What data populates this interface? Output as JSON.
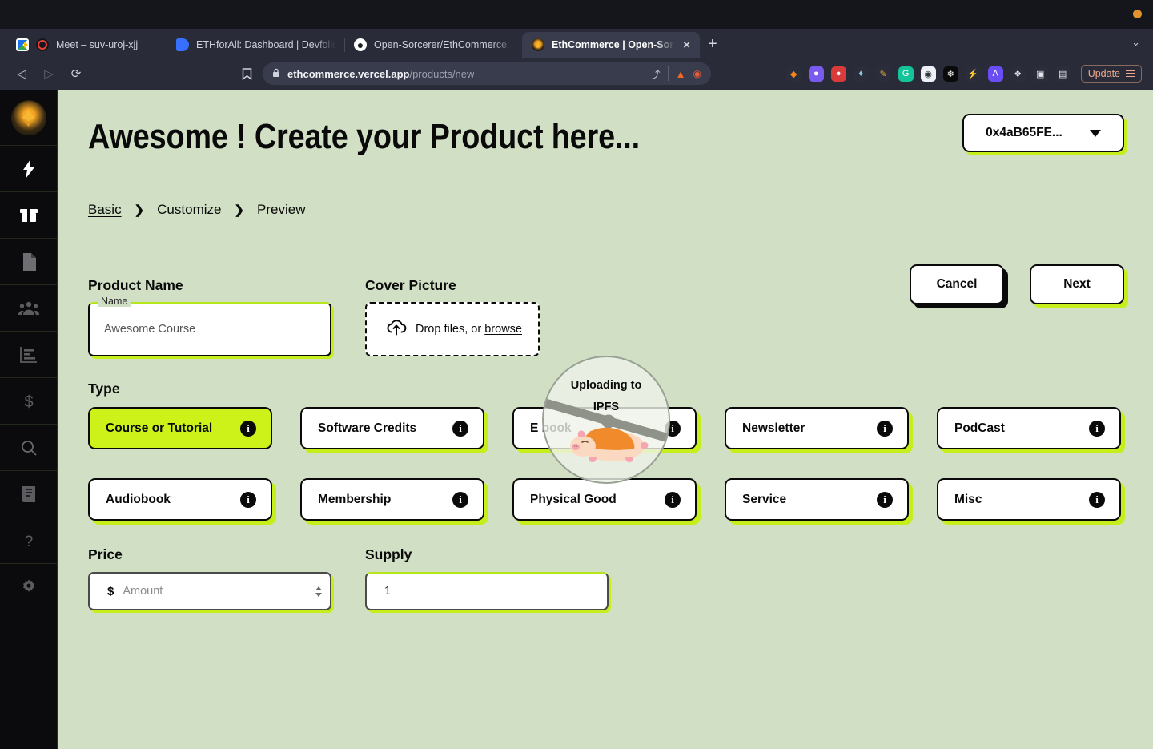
{
  "browser": {
    "tabs": [
      {
        "title": "Meet – suv-uroj-xjj",
        "favicon": "google-meet-icon",
        "active": false
      },
      {
        "title": "ETHforAll: Dashboard | Devfolio",
        "favicon": "devfolio-icon",
        "active": false
      },
      {
        "title": "Open-Sorcerer/EthCommerce: Toke",
        "favicon": "github-icon",
        "active": false
      },
      {
        "title": "EthCommerce | Open-Sorcerers",
        "favicon": "ethcommerce-icon",
        "active": true
      }
    ],
    "newtab_label": "+",
    "tab_close_label": "×",
    "tablist_chevron": "⌄",
    "nav": {
      "back": "◁",
      "forward": "▷",
      "reload": "⟳",
      "bookmark": "🔖"
    },
    "url": {
      "lock": "🔒",
      "domain": "ethcommerce.vercel.app",
      "path": "/products/new",
      "share": "⤴"
    },
    "extensions": [
      {
        "name": "metamask-extension",
        "glyph": "🦊",
        "color": "#2b2e3a"
      },
      {
        "name": "rabby-extension",
        "glyph": "●",
        "color": "#7a5bf0"
      },
      {
        "name": "keplr-extension",
        "glyph": "◆",
        "color": "#d93a3a"
      },
      {
        "name": "phantom-extension",
        "glyph": "⬧",
        "color": "#2b2e3a"
      },
      {
        "name": "colorpicker-extension",
        "glyph": "✒",
        "color": "#2b2e3a"
      },
      {
        "name": "grammarly-extension",
        "glyph": "G",
        "color": "#15c39a"
      },
      {
        "name": "coinbase-wallet-extension",
        "glyph": "●",
        "color": "#eef1f6"
      },
      {
        "name": "snowflake-extension",
        "glyph": "❄",
        "color": "#0a0a0a"
      },
      {
        "name": "lightning-extension",
        "glyph": "⚡",
        "color": "#2b2e3a"
      },
      {
        "name": "argent-extension",
        "glyph": "A",
        "color": "#6b4df6"
      },
      {
        "name": "puzzle-extensions-icon",
        "glyph": "🧩",
        "color": "#2b2e3a"
      },
      {
        "name": "sidepanel-icon",
        "glyph": "◱",
        "color": "#2b2e3a"
      },
      {
        "name": "wallet-icon",
        "glyph": "▤",
        "color": "#2b2e3a"
      }
    ],
    "update_label": "Update"
  },
  "sidebar": {
    "logo_name": "ethcommerce-logo",
    "items": [
      {
        "name": "sidebar-item-activity",
        "icon": "lightning-bolt-icon"
      },
      {
        "name": "sidebar-item-products",
        "icon": "package-box-icon"
      },
      {
        "name": "sidebar-item-documents",
        "icon": "document-icon"
      },
      {
        "name": "sidebar-item-customers",
        "icon": "users-group-icon"
      },
      {
        "name": "sidebar-item-analytics",
        "icon": "bar-chart-icon"
      },
      {
        "name": "sidebar-item-payments",
        "icon": "dollar-sign-icon"
      },
      {
        "name": "sidebar-item-search",
        "icon": "search-icon"
      },
      {
        "name": "sidebar-item-docs",
        "icon": "book-icon"
      },
      {
        "name": "sidebar-item-help",
        "icon": "question-mark-icon"
      },
      {
        "name": "sidebar-item-settings",
        "icon": "gear-icon"
      }
    ]
  },
  "page": {
    "title": "Awesome ! Create your Product here...",
    "wallet": {
      "address": "0x4aB65FE...",
      "caret": "▼"
    },
    "breadcrumbs": [
      {
        "label": "Basic",
        "active": true
      },
      {
        "label": "Customize",
        "active": false
      },
      {
        "label": "Preview",
        "active": false
      }
    ],
    "breadcrumb_separator": "❯",
    "actions": {
      "cancel": "Cancel",
      "next": "Next"
    }
  },
  "form": {
    "product_name": {
      "section_label": "Product Name",
      "float_label": "Name",
      "value": "Awesome Course",
      "placeholder": "Name"
    },
    "cover_picture": {
      "section_label": "Cover Picture",
      "icon": "upload-cloud-icon",
      "text_prefix": "Drop files, or ",
      "browse_label": "browse"
    },
    "type": {
      "section_label": "Type",
      "info_glyph": "i",
      "options": [
        {
          "label": "Course or Tutorial",
          "selected": true
        },
        {
          "label": "Software Credits",
          "selected": false
        },
        {
          "label": "E book",
          "selected": false
        },
        {
          "label": "Newsletter",
          "selected": false
        },
        {
          "label": "PodCast",
          "selected": false
        },
        {
          "label": "Audiobook",
          "selected": false
        },
        {
          "label": "Membership",
          "selected": false
        },
        {
          "label": "Physical Good",
          "selected": false
        },
        {
          "label": "Service",
          "selected": false
        },
        {
          "label": "Misc",
          "selected": false
        }
      ]
    },
    "price": {
      "section_label": "Price",
      "currency_symbol": "$",
      "value": "",
      "placeholder": "Amount"
    },
    "supply": {
      "section_label": "Supply",
      "value": "1",
      "placeholder": "1"
    }
  },
  "upload_overlay": {
    "text": "Uploading to IPFS",
    "illustration": "pig-illustration",
    "spinner": "loading-spinner"
  },
  "colors": {
    "background": "#d1e0c5",
    "accent_lime": "#ccf219",
    "shadow_lime": "#c6ee1b",
    "ink": "#0a0a0a",
    "chrome": "#292c38"
  }
}
